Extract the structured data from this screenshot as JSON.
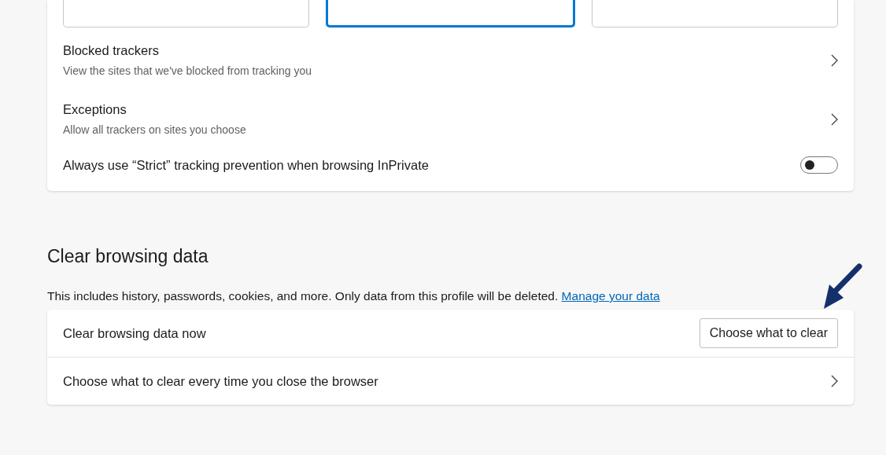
{
  "tracking_cards": [
    {
      "selected": false
    },
    {
      "selected": true
    },
    {
      "selected": false
    }
  ],
  "tracking_rows": [
    {
      "kind": "link",
      "title": "Blocked trackers",
      "subtitle": "View the sites that we've blocked from tracking you"
    },
    {
      "kind": "link",
      "title": "Exceptions",
      "subtitle": "Allow all trackers on sites you choose"
    },
    {
      "kind": "toggle",
      "title": "Always use “Strict” tracking prevention when browsing InPrivate",
      "on": false
    }
  ],
  "clear_section": {
    "heading": "Clear browsing data",
    "description": "This includes history, passwords, cookies, and more. Only data from this profile will be deleted.",
    "link": "Manage your data",
    "rows": [
      {
        "kind": "button",
        "title": "Clear browsing data now",
        "button": "Choose what to clear"
      },
      {
        "kind": "link",
        "title": "Choose what to clear every time you close the browser"
      }
    ]
  }
}
